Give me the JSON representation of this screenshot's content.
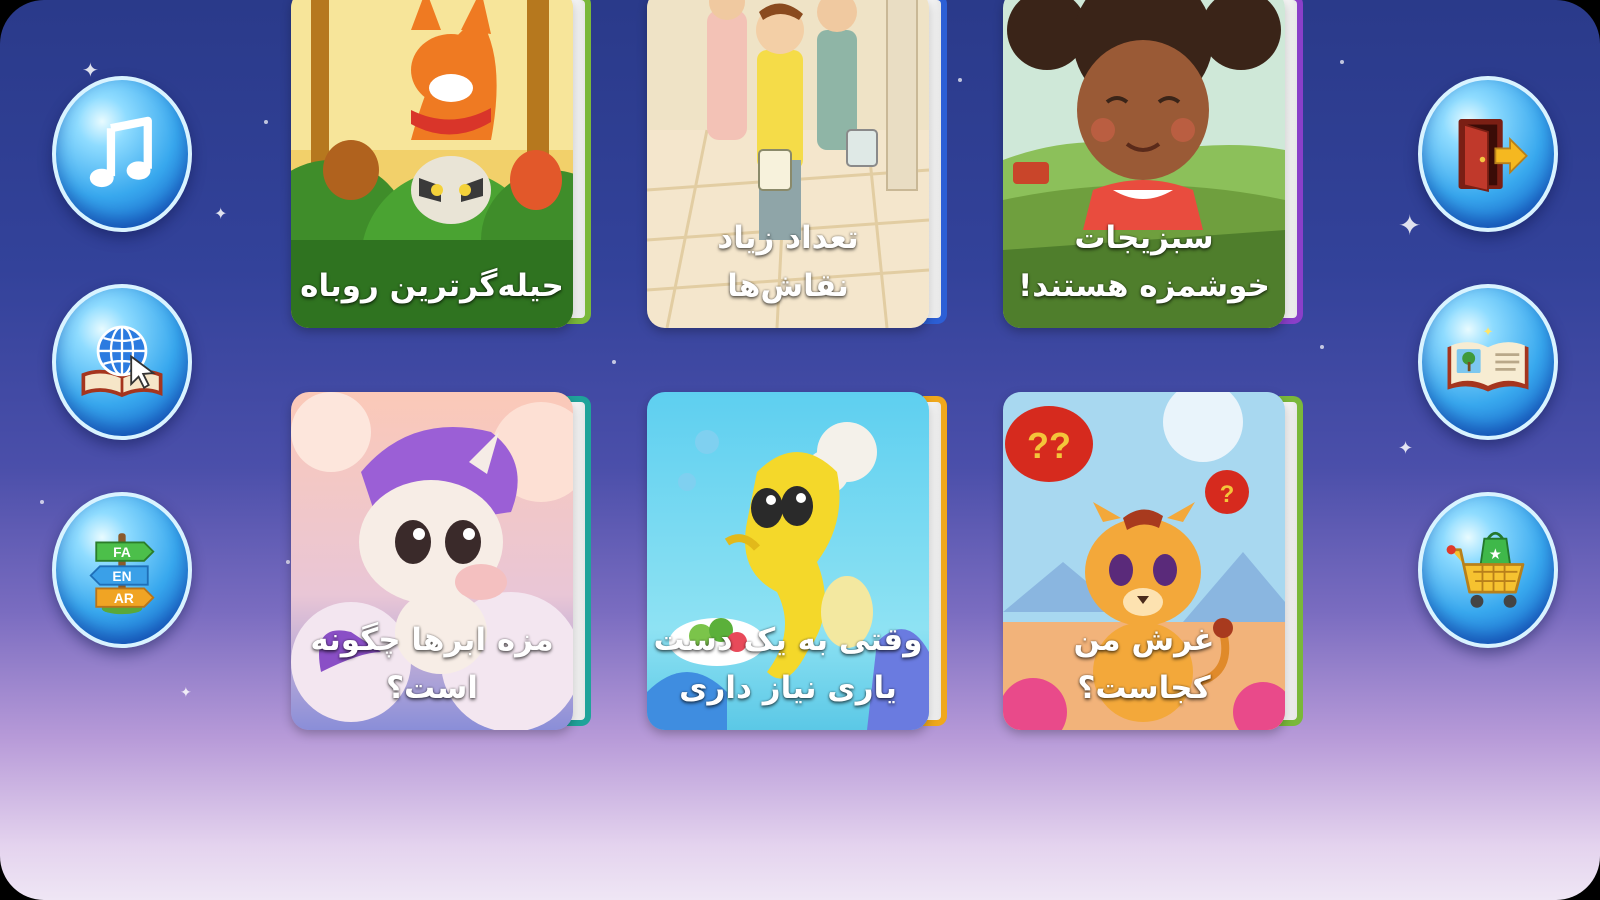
{
  "left_controls": [
    {
      "name": "music-button",
      "icon": "music-note-icon"
    },
    {
      "name": "online-library-button",
      "icon": "globe-book-icon"
    },
    {
      "name": "language-button",
      "icon": "language-signpost-icon",
      "languages": [
        "FA",
        "EN",
        "AR"
      ]
    }
  ],
  "right_controls": [
    {
      "name": "exit-button",
      "icon": "exit-door-icon"
    },
    {
      "name": "my-books-button",
      "icon": "open-book-icon"
    },
    {
      "name": "store-button",
      "icon": "shopping-cart-icon"
    }
  ],
  "books": [
    {
      "title": "حیله‌گرترین روباه",
      "spine_color": "#7ab83a",
      "art": "fox"
    },
    {
      "title": "تعداد زیاد نقاش‌ها",
      "spine_color": "#2c5fd6",
      "art": "painters"
    },
    {
      "title": "سبزیجات خوشمزه هستند!",
      "spine_color": "#8a3fc9",
      "art": "girl"
    },
    {
      "title": "مزه ابرها چگونه است؟",
      "spine_color": "#1fa39a",
      "art": "unicorn"
    },
    {
      "title": "وقتی به یک دست یاری نیاز داری",
      "spine_color": "#f0a81c",
      "art": "seahorse"
    },
    {
      "title": "غرش من کجاست؟",
      "spine_color": "#7ab83a",
      "art": "lion"
    }
  ],
  "colors": {
    "bg_top": "#2a3a8a",
    "bg_bottom": "#efe6f5",
    "bubble": "#38a8ee"
  }
}
